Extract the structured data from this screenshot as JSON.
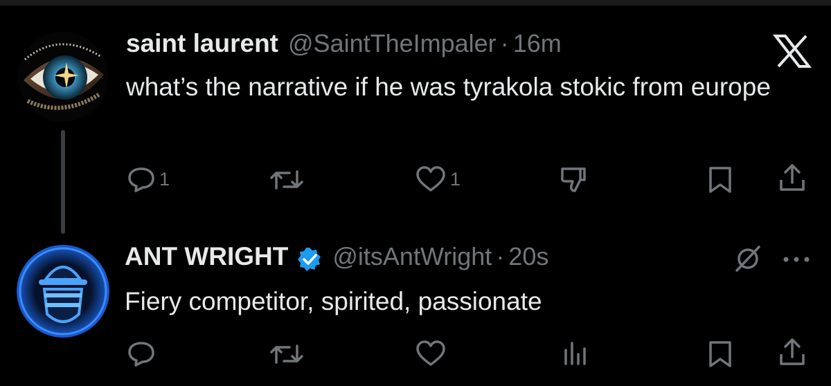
{
  "posts": [
    {
      "author_name": "saint laurent",
      "handle": "@SaintTheImpaler",
      "separator": "·",
      "time": "16m",
      "text": "what’s the narrative if he was tyrakola stokic from europe",
      "reply_count": "1",
      "like_count": "1"
    },
    {
      "author_name": "ANT WRIGHT",
      "handle": "@itsAntWright",
      "separator": "·",
      "time": "20s",
      "text": "Fiery competitor, spirited, passionate",
      "verified": true
    }
  ],
  "icons": [
    "reply-icon",
    "retweet-icon",
    "like-icon",
    "dislike-icon",
    "views-icon",
    "bookmark-icon",
    "share-icon",
    "x-logo-icon",
    "mute-icon",
    "more-icon",
    "verified-badge-icon"
  ],
  "colors": {
    "background": "#000000",
    "text": "#e7e9ea",
    "secondary": "#71767b",
    "verified": "#1d9bf0"
  }
}
